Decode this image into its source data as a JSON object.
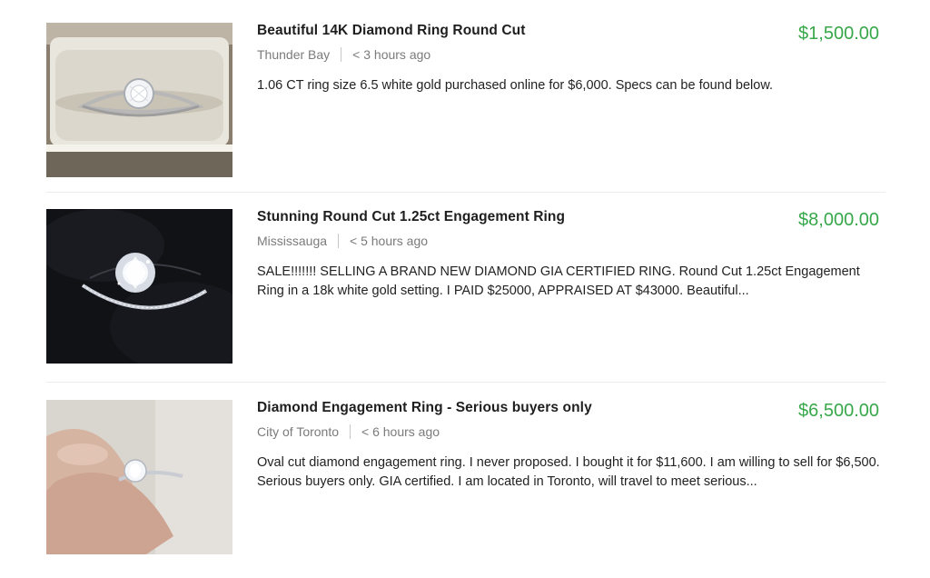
{
  "listings": [
    {
      "title": "Beautiful 14K Diamond Ring Round Cut",
      "location": "Thunder Bay",
      "posted": "< 3 hours ago",
      "price": "$1,500.00",
      "description": "1.06 CT ring size 6.5 white gold purchased online for $6,000. Specs can be found below.",
      "image": "ring-in-white-box-photo"
    },
    {
      "title": "Stunning Round Cut 1.25ct Engagement Ring",
      "location": "Mississauga",
      "posted": "< 5 hours ago",
      "price": "$8,000.00",
      "description": "SALE!!!!!!! SELLING A BRAND NEW DIAMOND GIA CERTIFIED RING. Round Cut 1.25ct Engagement Ring in a 18k white gold setting. I PAID $25000, APPRAISED AT $43000. Beautiful...",
      "image": "ring-on-black-velvet-photo"
    },
    {
      "title": "Diamond Engagement Ring - Serious buyers only",
      "location": "City of Toronto",
      "posted": "< 6 hours ago",
      "price": "$6,500.00",
      "description": "Oval cut diamond engagement ring. I never proposed. I bought it for $11,600. I am willing to sell for $6,500. Serious buyers only. GIA certified. I am located in Toronto, will travel to meet serious...",
      "image": "ring-held-in-hand-photo"
    }
  ],
  "colors": {
    "price": "#37a84a",
    "title": "#1e1e1e",
    "meta": "#7b7b7b",
    "divider": "#ececec"
  }
}
